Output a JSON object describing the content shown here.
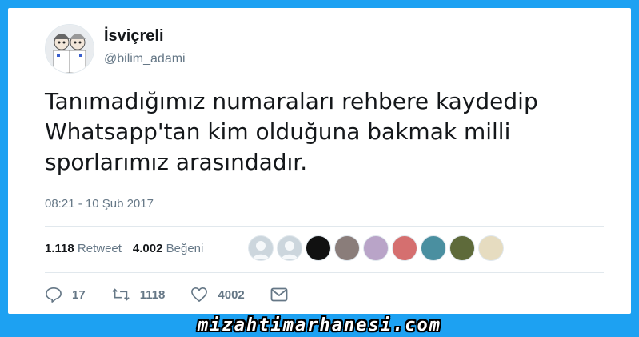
{
  "tweet": {
    "user_name": "İsviçreli",
    "user_handle": "@bilim_adami",
    "text_lines": [
      "Tanımadığımız numaraları rehbere kaydedip",
      "Whatsapp'tan kim olduğuna bakmak milli",
      "sporlarımız arasındadır."
    ],
    "timestamp": "08:21 - 10 Şub 2017",
    "retweet_count": "1.118",
    "retweet_label": "Retweet",
    "like_count": "4.002",
    "like_label": "Beğeni"
  },
  "likers": [
    {
      "icon": "default-avatar",
      "color": "#ccd6dd"
    },
    {
      "icon": "default-avatar",
      "color": "#ccd6dd"
    },
    {
      "icon": "dark-avatar",
      "color": "#111111"
    },
    {
      "icon": "photo-avatar",
      "color": "#8a7d7a"
    },
    {
      "icon": "photo-avatar",
      "color": "#b9a4c8"
    },
    {
      "icon": "photo-avatar",
      "color": "#d56f6f"
    },
    {
      "icon": "photo-avatar",
      "color": "#4a8fa0"
    },
    {
      "icon": "photo-avatar",
      "color": "#5e6a3a"
    },
    {
      "icon": "photo-avatar",
      "color": "#e6dcc0"
    }
  ],
  "actions": {
    "reply_count": "17",
    "retweet_count": "1118",
    "like_count": "4002"
  },
  "watermark": "mizahtimarhanesi.com",
  "colors": {
    "background": "#1da1f2",
    "text": "#14171a",
    "secondary": "#657786"
  }
}
